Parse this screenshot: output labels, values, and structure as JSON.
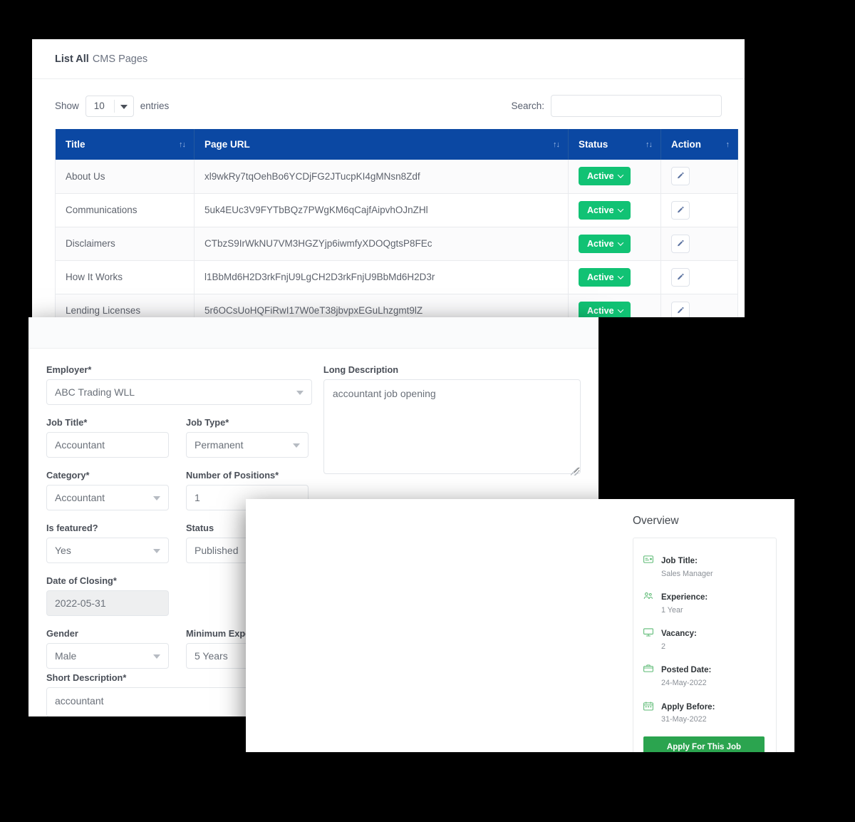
{
  "cms_panel": {
    "header": {
      "strong": "List All",
      "light": "CMS Pages"
    },
    "length_menu": {
      "prefix": "Show",
      "value": "10",
      "suffix": "entries"
    },
    "search": {
      "label": "Search:",
      "value": "",
      "placeholder": ""
    },
    "columns": [
      {
        "label": "Title",
        "sorter": "↑↓"
      },
      {
        "label": "Page URL",
        "sorter": "↑↓"
      },
      {
        "label": "Status",
        "sorter": "↑↓"
      },
      {
        "label": "Action",
        "sorter": "↑"
      }
    ],
    "rows": [
      {
        "title": "About Us",
        "url": "xl9wkRy7tqOehBo6YCDjFG2JTucpKI4gMNsn8Zdf",
        "status": "Active",
        "action_icon": "pencil-icon"
      },
      {
        "title": "Communications",
        "url": "5uk4EUc3V9FYTbBQz7PWgKM6qCajfAipvhOJnZHl",
        "status": "Active",
        "action_icon": "pencil-icon"
      },
      {
        "title": "Disclaimers",
        "url": "CTbzS9IrWkNU7VM3HGZYjp6iwmfyXDOQgtsP8FEc",
        "status": "Active",
        "action_icon": "pencil-icon"
      },
      {
        "title": "How It Works",
        "url": "l1BbMd6H2D3rkFnjU9LgCH2D3rkFnjU9BbMd6H2D3r",
        "status": "Active",
        "action_icon": "pencil-icon"
      },
      {
        "title": "Lending Licenses",
        "url": "5r6OCsUoHQFiRwI17W0eT38jbvpxEGuLhzgmt9lZ",
        "status": "Active",
        "action_icon": "pencil-icon"
      }
    ],
    "status_caret": "chevron-down-icon"
  },
  "job_form": {
    "employer": {
      "label": "Employer*",
      "value": "ABC Trading WLL"
    },
    "job_title": {
      "label": "Job Title*",
      "value": "Accountant"
    },
    "job_type": {
      "label": "Job Type*",
      "value": "Permanent"
    },
    "category": {
      "label": "Category*",
      "value": "Accountant"
    },
    "positions": {
      "label": "Number of Positions*",
      "value": "1"
    },
    "featured": {
      "label": "Is featured?",
      "value": "Yes"
    },
    "status": {
      "label": "Status",
      "value": "Published"
    },
    "closing": {
      "label": "Date of Closing*",
      "value": "2022-05-31"
    },
    "gender": {
      "label": "Gender",
      "value": "Male"
    },
    "min_exp": {
      "label": "Minimum Experience*",
      "value": "5 Years"
    },
    "short_desc": {
      "label": "Short Description*",
      "value": "accountant"
    },
    "long_desc": {
      "label": "Long Description",
      "value": "accountant job opening"
    }
  },
  "overview_panel": {
    "title": "Overview",
    "items": [
      {
        "icon": "id-card-icon",
        "key": "Job Title:",
        "value": "Sales Manager"
      },
      {
        "icon": "users-icon",
        "key": "Experience:",
        "value": "1 Year"
      },
      {
        "icon": "monitor-icon",
        "key": "Vacancy:",
        "value": "2"
      },
      {
        "icon": "briefcase-icon",
        "key": "Posted Date:",
        "value": "24-May-2022"
      },
      {
        "icon": "calendar-icon",
        "key": "Apply Before:",
        "value": "31-May-2022"
      }
    ],
    "apply_button": "Apply For This Job"
  },
  "colors": {
    "table_header_blue": "#0b48a3",
    "badge_green": "#11c274",
    "apply_green": "#2ba44f",
    "backdrop": "#000000"
  }
}
